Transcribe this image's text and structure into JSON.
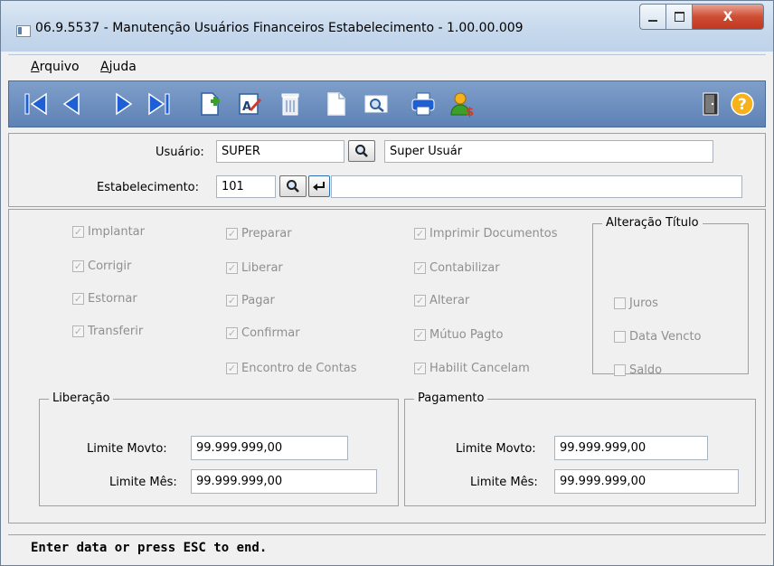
{
  "window": {
    "title": "06.9.5537 - Manutenção Usuários Financeiros Estabelecimento - 1.00.00.009",
    "controls": {
      "minimize": "—",
      "maximize": "□",
      "close": "X"
    }
  },
  "menu": [
    {
      "label": "Arquivo",
      "accel": "A",
      "rest": "rquivo"
    },
    {
      "label": "Ajuda",
      "accel": "A",
      "rest": "juda"
    }
  ],
  "toolbar": {
    "icons": [
      "first-icon",
      "prev-icon",
      "next-icon",
      "last-icon",
      "add-icon",
      "edit-icon",
      "delete-icon",
      "new-doc-icon",
      "zoom-icon",
      "print-icon",
      "user-dollar-icon",
      "exit-door-icon",
      "help-icon"
    ],
    "colors": {
      "nav": "#1e5fd6",
      "accent": "#f5b21a",
      "add": "#3aa02a"
    }
  },
  "header": {
    "usuario_label": "Usuário:",
    "usuario_value": "SUPER",
    "usuario_name": "Super Usuár",
    "estab_label": "Estabelecimento:",
    "estab_value": "101",
    "estab_name": ""
  },
  "permissions": {
    "col1": [
      "Implantar",
      "Corrigir",
      "Estornar",
      "Transferir"
    ],
    "col2": [
      "Preparar",
      "Liberar",
      "Pagar",
      "Confirmar",
      "Encontro de Contas"
    ],
    "col3": [
      "Imprimir Documentos",
      "Contabilizar",
      "Alterar",
      "Mútuo Pagto",
      "Habilit Cancelam"
    ]
  },
  "alteracao": {
    "title": "Alteração Título",
    "items": [
      "Juros",
      "Data Vencto",
      "Saldo"
    ]
  },
  "liberacao": {
    "title": "Liberação",
    "limite_movto_label": "Limite Movto:",
    "limite_movto_value": "99.999.999,00",
    "limite_mes_label": "Limite Mês:",
    "limite_mes_value": "99.999.999,00"
  },
  "pagamento": {
    "title": "Pagamento",
    "limite_movto_label": "Limite Movto:",
    "limite_movto_value": "99.999.999,00",
    "limite_mes_label": "Limite Mês:",
    "limite_mes_value": "99.999.999,00"
  },
  "status": "Enter data or press ESC to end."
}
